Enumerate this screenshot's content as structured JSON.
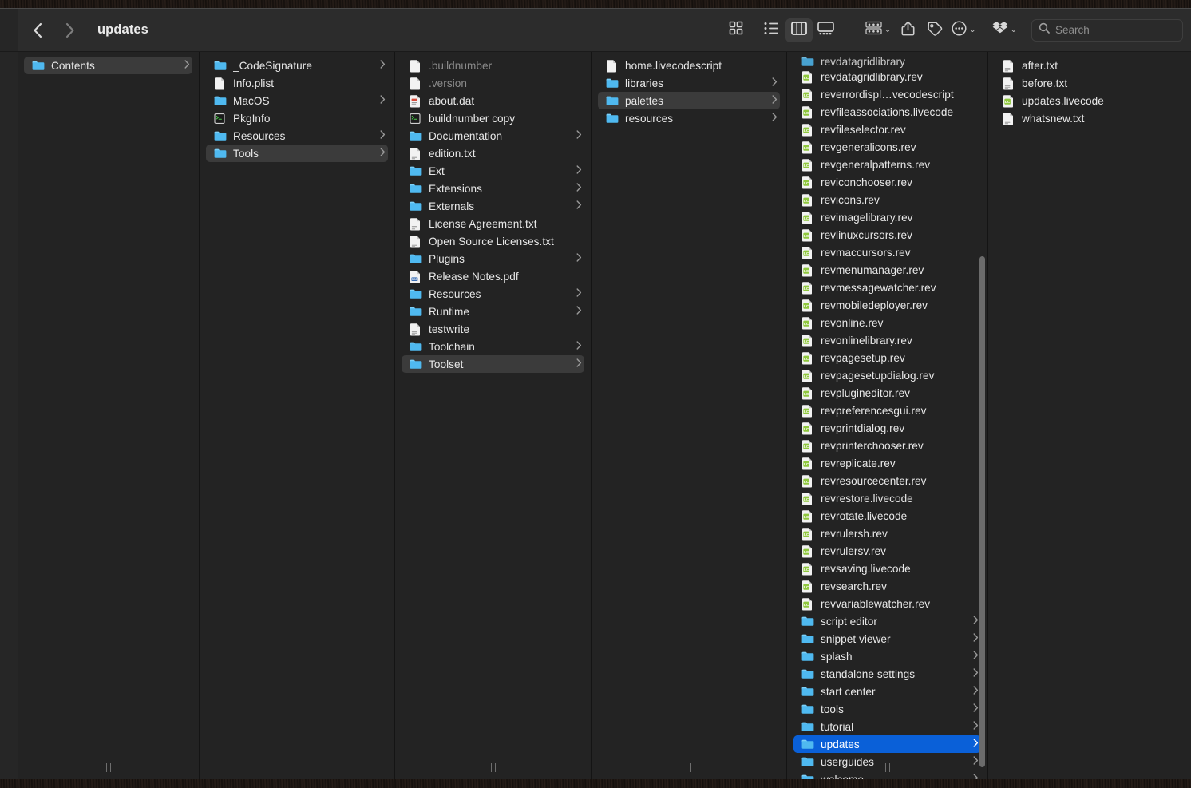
{
  "window": {
    "title": "updates",
    "back_label": "‹",
    "forward_label": "›"
  },
  "toolbar": {
    "icon_view": "icon-view-icon",
    "list_view": "list-view-icon",
    "column_view": "column-view-icon",
    "gallery_view": "gallery-view-icon",
    "group_by": "group-by-icon",
    "share": "share-icon",
    "tags": "tag-icon",
    "more": "more-actions-icon",
    "dropbox": "dropbox-icon",
    "caret": "⌄",
    "active_view": "column_view"
  },
  "search": {
    "placeholder": "Search",
    "value": "",
    "icon": "search-icon"
  },
  "colors": {
    "selection_blue": "#0a60d8",
    "selection_gray": "#3b3b3b",
    "folder_blue": "#5ec2f7",
    "livecode_green": "#8fc73e",
    "window_bg": "#232323",
    "toolbar_bg": "#2c2c2c"
  },
  "columns": [
    {
      "name": "column-1",
      "items": [
        {
          "label": "Contents",
          "type": "folder",
          "arrow": true,
          "state": "selected-inactive"
        }
      ]
    },
    {
      "name": "column-2",
      "items": [
        {
          "label": "_CodeSignature",
          "type": "folder",
          "arrow": true
        },
        {
          "label": "Info.plist",
          "type": "file"
        },
        {
          "label": "MacOS",
          "type": "folder",
          "arrow": true
        },
        {
          "label": "PkgInfo",
          "type": "exec"
        },
        {
          "label": "Resources",
          "type": "folder",
          "arrow": true
        },
        {
          "label": "Tools",
          "type": "folder",
          "arrow": true,
          "state": "selected-inactive"
        }
      ]
    },
    {
      "name": "column-3",
      "items": [
        {
          "label": ".buildnumber",
          "type": "file",
          "state": "hidden"
        },
        {
          "label": ".version",
          "type": "file",
          "state": "hidden"
        },
        {
          "label": "about.dat",
          "type": "doc"
        },
        {
          "label": "buildnumber copy",
          "type": "exec"
        },
        {
          "label": "Documentation",
          "type": "folder",
          "arrow": true
        },
        {
          "label": "edition.txt",
          "type": "text"
        },
        {
          "label": "Ext",
          "type": "folder",
          "arrow": true
        },
        {
          "label": "Extensions",
          "type": "folder",
          "arrow": true
        },
        {
          "label": "Externals",
          "type": "folder",
          "arrow": true
        },
        {
          "label": "License Agreement.txt",
          "type": "text"
        },
        {
          "label": "Open Source Licenses.txt",
          "type": "text"
        },
        {
          "label": "Plugins",
          "type": "folder",
          "arrow": true
        },
        {
          "label": "Release Notes.pdf",
          "type": "pdf"
        },
        {
          "label": "Resources",
          "type": "folder",
          "arrow": true
        },
        {
          "label": "Runtime",
          "type": "folder",
          "arrow": true
        },
        {
          "label": "testwrite",
          "type": "text"
        },
        {
          "label": "Toolchain",
          "type": "folder",
          "arrow": true
        },
        {
          "label": "Toolset",
          "type": "folder",
          "arrow": true,
          "state": "selected-inactive"
        }
      ]
    },
    {
      "name": "column-4",
      "items": [
        {
          "label": "home.livecodescript",
          "type": "file"
        },
        {
          "label": "libraries",
          "type": "folder",
          "arrow": true
        },
        {
          "label": "palettes",
          "type": "folder",
          "arrow": true,
          "state": "selected-inactive"
        },
        {
          "label": "resources",
          "type": "folder",
          "arrow": true
        }
      ]
    },
    {
      "name": "column-5",
      "scrolled": true,
      "clipped_top_item": {
        "label": "revdatagridlibrary",
        "type": "folder"
      },
      "items": [
        {
          "label": "revdatagridlibrary.rev",
          "type": "livecode"
        },
        {
          "label": "reverrordispl…vecodescript",
          "type": "livecode"
        },
        {
          "label": "revfileassociations.livecode",
          "type": "livecode"
        },
        {
          "label": "revfileselector.rev",
          "type": "livecode"
        },
        {
          "label": "revgeneralicons.rev",
          "type": "livecode"
        },
        {
          "label": "revgeneralpatterns.rev",
          "type": "livecode"
        },
        {
          "label": "reviconchooser.rev",
          "type": "livecode"
        },
        {
          "label": "revicons.rev",
          "type": "livecode"
        },
        {
          "label": "revimagelibrary.rev",
          "type": "livecode"
        },
        {
          "label": "revlinuxcursors.rev",
          "type": "livecode"
        },
        {
          "label": "revmaccursors.rev",
          "type": "livecode"
        },
        {
          "label": "revmenumanager.rev",
          "type": "livecode"
        },
        {
          "label": "revmessagewatcher.rev",
          "type": "livecode"
        },
        {
          "label": "revmobiledeployer.rev",
          "type": "livecode"
        },
        {
          "label": "revonline.rev",
          "type": "livecode"
        },
        {
          "label": "revonlinelibrary.rev",
          "type": "livecode"
        },
        {
          "label": "revpagesetup.rev",
          "type": "livecode"
        },
        {
          "label": "revpagesetupdialog.rev",
          "type": "livecode"
        },
        {
          "label": "revplugineditor.rev",
          "type": "livecode"
        },
        {
          "label": "revpreferencesgui.rev",
          "type": "livecode"
        },
        {
          "label": "revprintdialog.rev",
          "type": "livecode"
        },
        {
          "label": "revprinterchooser.rev",
          "type": "livecode"
        },
        {
          "label": "revreplicate.rev",
          "type": "livecode"
        },
        {
          "label": "revresourcecenter.rev",
          "type": "livecode"
        },
        {
          "label": "revrestore.livecode",
          "type": "livecode"
        },
        {
          "label": "revrotate.livecode",
          "type": "livecode"
        },
        {
          "label": "revrulersh.rev",
          "type": "livecode"
        },
        {
          "label": "revrulersv.rev",
          "type": "livecode"
        },
        {
          "label": "revsaving.livecode",
          "type": "livecode"
        },
        {
          "label": "revsearch.rev",
          "type": "livecode"
        },
        {
          "label": "revvariablewatcher.rev",
          "type": "livecode"
        },
        {
          "label": "script editor",
          "type": "folder",
          "arrow": true
        },
        {
          "label": "snippet viewer",
          "type": "folder",
          "arrow": true
        },
        {
          "label": "splash",
          "type": "folder",
          "arrow": true
        },
        {
          "label": "standalone settings",
          "type": "folder",
          "arrow": true
        },
        {
          "label": "start center",
          "type": "folder",
          "arrow": true
        },
        {
          "label": "tools",
          "type": "folder",
          "arrow": true
        },
        {
          "label": "tutorial",
          "type": "folder",
          "arrow": true
        },
        {
          "label": "updates",
          "type": "folder",
          "arrow": true,
          "state": "selected-active"
        },
        {
          "label": "userguides",
          "type": "folder",
          "arrow": true
        },
        {
          "label": "welcome",
          "type": "folder",
          "arrow": true
        }
      ]
    },
    {
      "name": "column-6",
      "items": [
        {
          "label": "after.txt",
          "type": "text"
        },
        {
          "label": "before.txt",
          "type": "text"
        },
        {
          "label": "updates.livecode",
          "type": "livecode"
        },
        {
          "label": "whatsnew.txt",
          "type": "text"
        }
      ]
    }
  ]
}
